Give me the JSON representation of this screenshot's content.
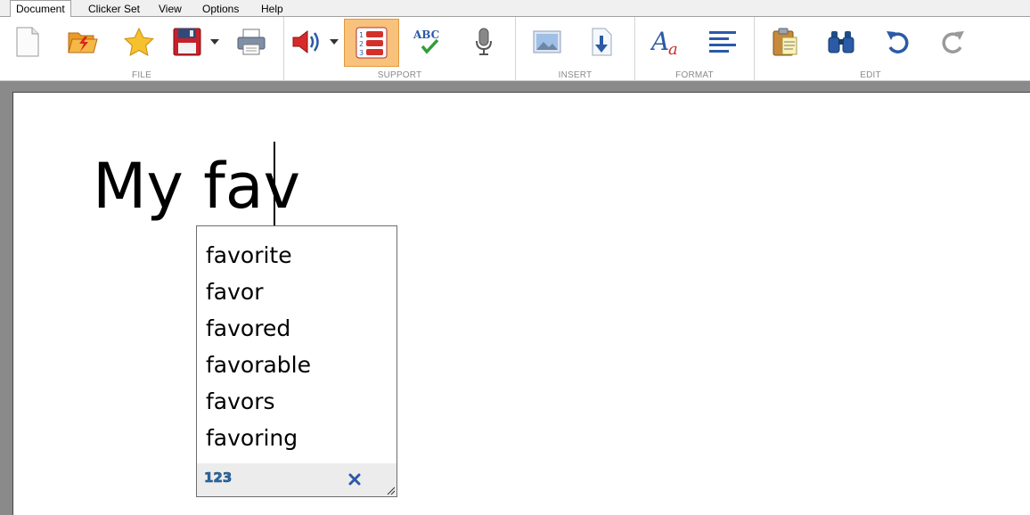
{
  "menu": {
    "tabs": [
      "Document",
      "Clicker Set",
      "View",
      "Options",
      "Help"
    ]
  },
  "ribbon": {
    "groups": {
      "file": "FILE",
      "support": "SUPPORT",
      "insert": "INSERT",
      "format": "FORMAT",
      "edit": "EDIT"
    },
    "spell_check_glyph": "ABC",
    "active_button": "predictor",
    "accent_color": "#f8c27d"
  },
  "document": {
    "text": "My fav"
  },
  "predictor": {
    "suggestions": [
      "favorite",
      "favor",
      "favored",
      "favorable",
      "favors",
      "favoring"
    ],
    "number_icon_glyph": "123"
  }
}
